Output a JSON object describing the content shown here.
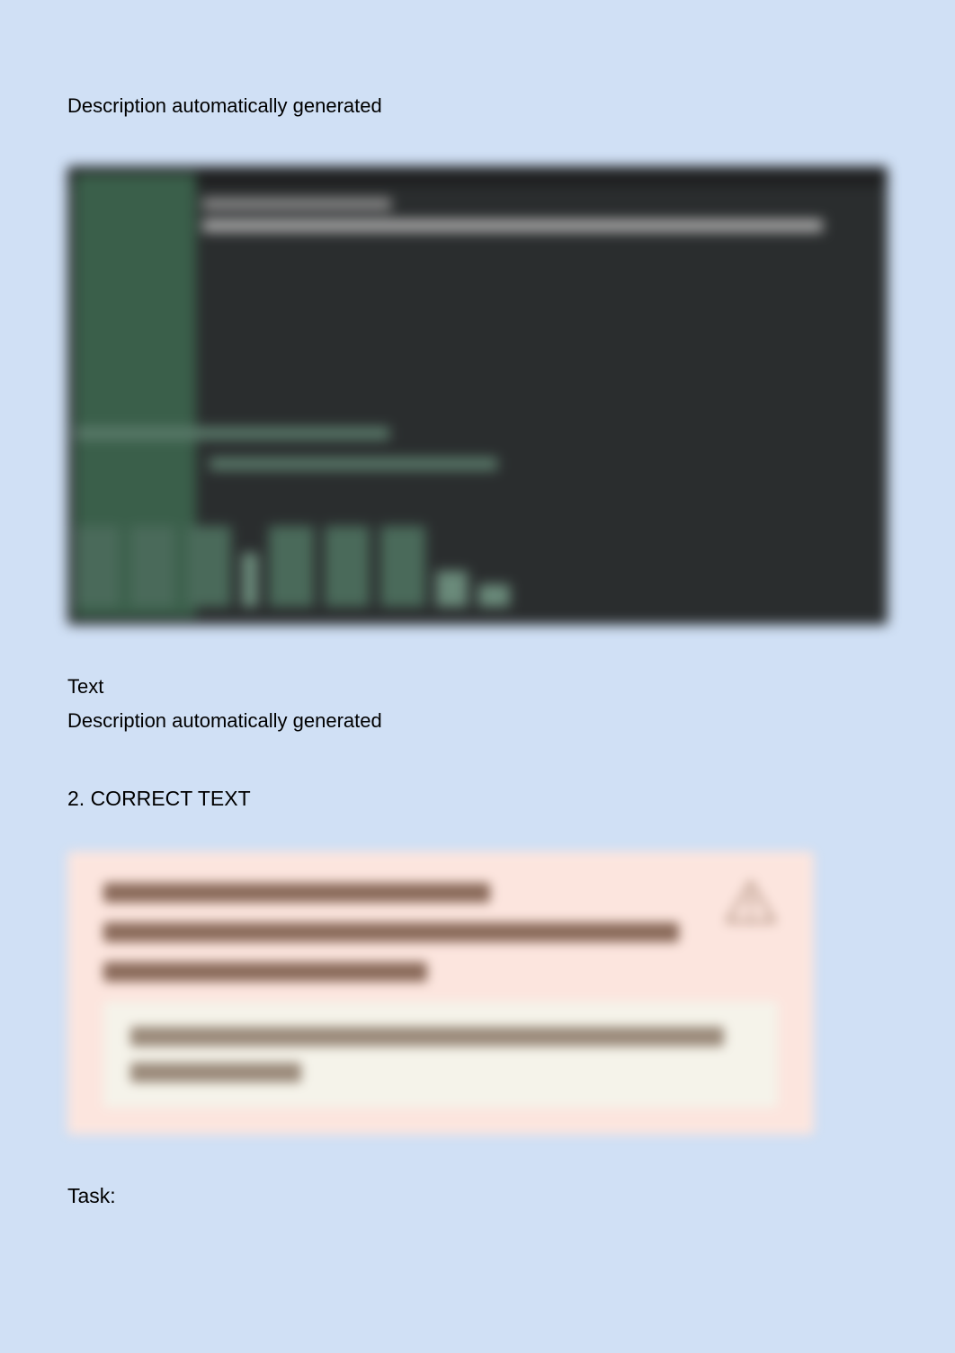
{
  "captions": {
    "caption1": "Description automatically generated",
    "text_label": "Text",
    "caption2": "Description automatically generated"
  },
  "section": {
    "heading": "2. CORRECT TEXT"
  },
  "warning_box": {
    "message": "You must switch to the correct cluster/configuration context. Failure to do so may result in a zero score.",
    "code_prompt": "[candidate@cli] $",
    "code_command": "kubectl config use-context sk8s"
  },
  "task": {
    "label": "Task:"
  }
}
